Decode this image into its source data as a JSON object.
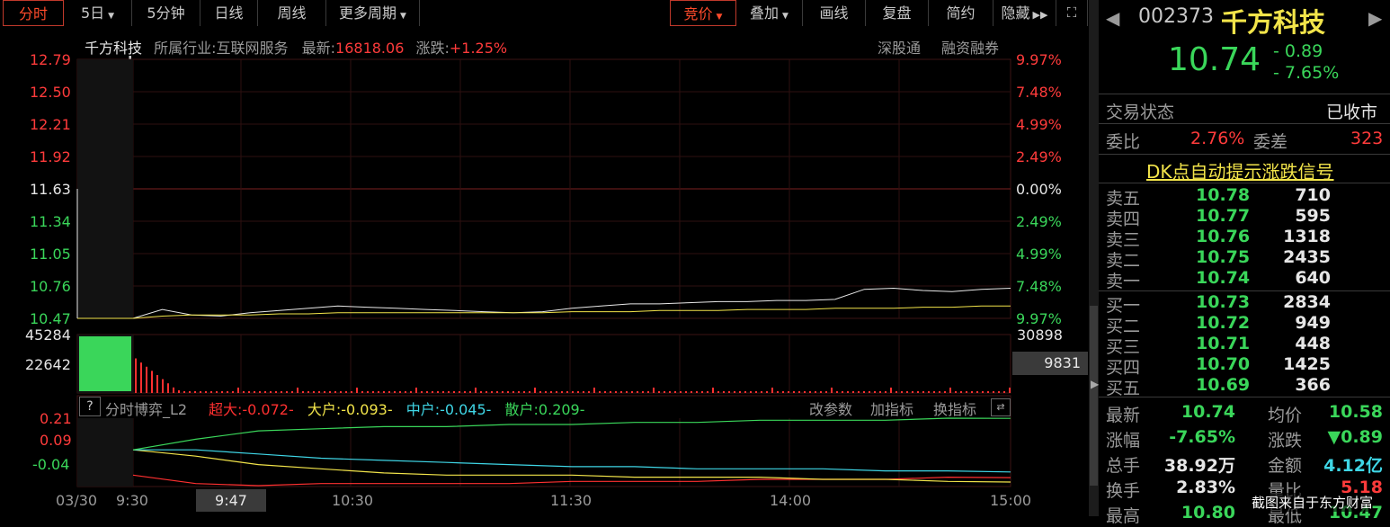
{
  "toolbar": {
    "left_buttons": [
      {
        "label": "分时",
        "active": true
      },
      {
        "label": "5日",
        "dropdown": true
      },
      {
        "label": "5分钟",
        "dropdown": false
      },
      {
        "label": "日线",
        "dropdown": false
      },
      {
        "label": "周线",
        "dropdown": false
      },
      {
        "label": "更多周期",
        "dropdown": true
      }
    ],
    "right_buttons": [
      {
        "label": "竞价",
        "dropdown": true,
        "active": true
      },
      {
        "label": "叠加",
        "dropdown": true
      },
      {
        "label": "画线"
      },
      {
        "label": "复盘"
      },
      {
        "label": "简约"
      },
      {
        "label": "隐藏"
      }
    ]
  },
  "info_bar": {
    "name": "千方科技",
    "industry_label": "所属行业:",
    "industry": "互联网服务",
    "latest_label": "最新:",
    "latest": "16818.06",
    "change_label": "涨跌:",
    "change": "+1.25%",
    "link1": "深股通",
    "link2": "融资融券"
  },
  "price_axis": {
    "left": [
      "12.79",
      "12.50",
      "12.21",
      "11.92",
      "11.63",
      "11.34",
      "11.05",
      "10.76",
      "10.47"
    ],
    "right": [
      "9.97%",
      "7.48%",
      "4.99%",
      "2.49%",
      "0.00%",
      "2.49%",
      "4.99%",
      "7.48%",
      "9.97%"
    ]
  },
  "volume_axis": {
    "left": [
      "45284",
      "22642"
    ],
    "right_top": "30898",
    "right_badge": "9831"
  },
  "indicator": {
    "help": "?",
    "name": "分时博弈_L2",
    "items": [
      {
        "label": "超大:-0.072-",
        "color": "#ff3030"
      },
      {
        "label": "大户:-0.093-",
        "color": "#f2e44a"
      },
      {
        "label": "中户:-0.045-",
        "color": "#3fd6e6"
      },
      {
        "label": "散户:0.209-",
        "color": "#3ad65a"
      }
    ],
    "buttons": [
      "改参数",
      "加指标",
      "换指标"
    ],
    "y_labels": [
      "0.21",
      "0.09",
      "-0.04"
    ]
  },
  "time_axis": [
    "03/30",
    "9:30",
    "9:47",
    "10:30",
    "11:30",
    "14:00",
    "15:00"
  ],
  "chart_data": {
    "type": "line",
    "title": "",
    "price_range": [
      10.47,
      12.79
    ],
    "prev_close": 11.63,
    "price_series": [
      {
        "name": "price",
        "points": [
          10.47,
          10.47,
          10.55,
          10.5,
          10.49,
          10.52,
          10.54,
          10.56,
          10.58,
          10.57,
          10.56,
          10.55,
          10.54,
          10.53,
          10.52,
          10.53,
          10.56,
          10.58,
          10.6,
          10.6,
          10.61,
          10.62,
          10.62,
          10.63,
          10.63,
          10.64,
          10.73,
          10.74,
          10.72,
          10.71,
          10.73,
          10.74
        ]
      },
      {
        "name": "avg",
        "points": [
          10.47,
          10.47,
          10.49,
          10.5,
          10.5,
          10.5,
          10.51,
          10.51,
          10.52,
          10.52,
          10.52,
          10.52,
          10.52,
          10.52,
          10.52,
          10.52,
          10.53,
          10.53,
          10.53,
          10.54,
          10.54,
          10.54,
          10.55,
          10.55,
          10.55,
          10.56,
          10.56,
          10.56,
          10.57,
          10.57,
          10.58,
          10.58
        ]
      }
    ],
    "indicator_series": [
      {
        "name": "超大",
        "color": "#ff3030",
        "points": [
          -0.06,
          -0.1,
          -0.11,
          -0.1,
          -0.1,
          -0.1,
          -0.1,
          -0.09,
          -0.09,
          -0.09,
          -0.08,
          -0.08,
          -0.08,
          -0.07,
          -0.072
        ]
      },
      {
        "name": "大户",
        "color": "#f2e44a",
        "points": [
          0.06,
          0.03,
          -0.01,
          -0.03,
          -0.05,
          -0.06,
          -0.06,
          -0.06,
          -0.07,
          -0.07,
          -0.07,
          -0.08,
          -0.08,
          -0.09,
          -0.093
        ]
      },
      {
        "name": "中户",
        "color": "#3fd6e6",
        "points": [
          0.06,
          0.06,
          0.04,
          0.02,
          0.01,
          0.0,
          -0.01,
          -0.02,
          -0.02,
          -0.03,
          -0.03,
          -0.03,
          -0.04,
          -0.04,
          -0.045
        ]
      },
      {
        "name": "散户",
        "color": "#3ad65a",
        "points": [
          0.06,
          0.11,
          0.15,
          0.16,
          0.17,
          0.17,
          0.18,
          0.18,
          0.19,
          0.19,
          0.2,
          0.2,
          0.2,
          0.21,
          0.209
        ]
      }
    ]
  },
  "panel": {
    "code": "002373",
    "name": "千方科技",
    "price": "10.74",
    "change": "- 0.89",
    "change_pct": "- 7.65%",
    "trade_status_label": "交易状态",
    "trade_status": "已收市",
    "wb_label": "委比",
    "wb": "2.76%",
    "wc_label": "委差",
    "wc": "323",
    "signal_link": "DK点自动提示涨跌信号",
    "asks": [
      {
        "label": "卖五",
        "price": "10.78",
        "vol": "710"
      },
      {
        "label": "卖四",
        "price": "10.77",
        "vol": "595"
      },
      {
        "label": "卖三",
        "price": "10.76",
        "vol": "1318"
      },
      {
        "label": "卖二",
        "price": "10.75",
        "vol": "2435"
      },
      {
        "label": "卖一",
        "price": "10.74",
        "vol": "640"
      }
    ],
    "bids": [
      {
        "label": "买一",
        "price": "10.73",
        "vol": "2834"
      },
      {
        "label": "买二",
        "price": "10.72",
        "vol": "949"
      },
      {
        "label": "买三",
        "price": "10.71",
        "vol": "448"
      },
      {
        "label": "买四",
        "price": "10.70",
        "vol": "1425"
      },
      {
        "label": "买五",
        "price": "10.69",
        "vol": "366"
      }
    ],
    "stats": [
      {
        "l1": "最新",
        "v1": "10.74",
        "c1": "green",
        "l2": "均价",
        "v2": "10.58",
        "c2": "green"
      },
      {
        "l1": "涨幅",
        "v1": "-7.65%",
        "c1": "green",
        "l2": "涨跌",
        "v2": "▼0.89",
        "c2": "green"
      },
      {
        "l1": "总手",
        "v1": "38.92万",
        "c1": "white",
        "l2": "金额",
        "v2": "4.12亿",
        "c2": "cyan"
      },
      {
        "l1": "换手",
        "v1": "2.83%",
        "c1": "white",
        "l2": "量比",
        "v2": "5.18",
        "c2": "red"
      },
      {
        "l1": "最高",
        "v1": "10.80",
        "c1": "green",
        "l2": "最低",
        "v2": "10.47",
        "c2": "green"
      }
    ],
    "watermark": "截图来自于东方财富"
  }
}
